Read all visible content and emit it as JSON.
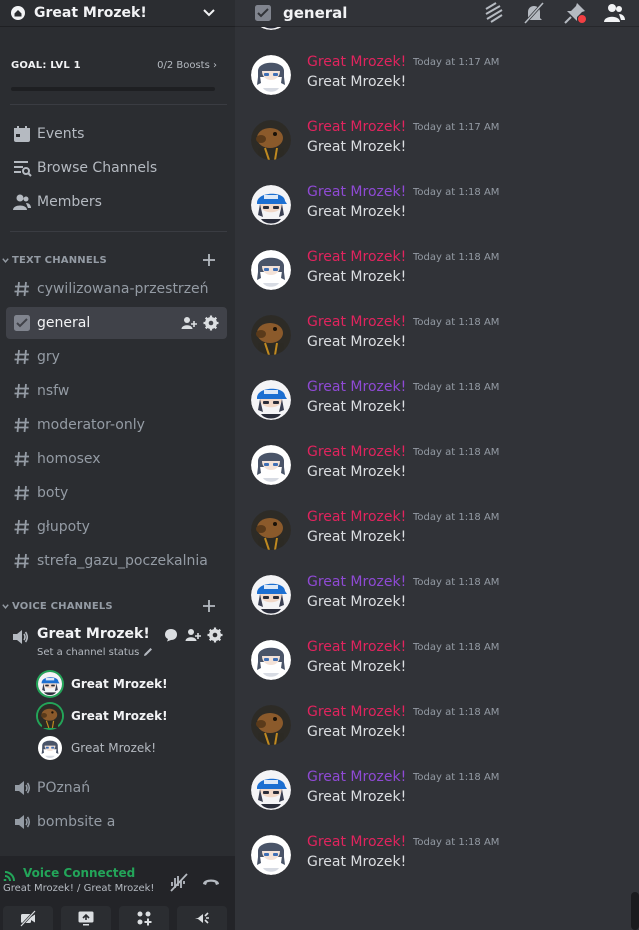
{
  "server": {
    "name": "Great Mrozek!"
  },
  "goal": {
    "label": "GOAL: LVL 1",
    "boosts": "0/2 Boosts",
    "progress": 0
  },
  "nav": [
    {
      "label": "Events",
      "icon": "calendar-icon"
    },
    {
      "label": "Browse Channels",
      "icon": "browse-channels-icon"
    },
    {
      "label": "Members",
      "icon": "members-icon"
    }
  ],
  "text_category": "TEXT CHANNELS",
  "text_channels": [
    {
      "name": "cywilizowana-przestrzeń",
      "icon": "hashtag-icon"
    },
    {
      "name": "general",
      "icon": "forum-icon",
      "active": true
    },
    {
      "name": "gry",
      "icon": "hashtag-icon"
    },
    {
      "name": "nsfw",
      "icon": "hashtag-icon"
    },
    {
      "name": "moderator-only",
      "icon": "hashtag-icon"
    },
    {
      "name": "homosex",
      "icon": "hashtag-icon"
    },
    {
      "name": "boty",
      "icon": "hashtag-icon"
    },
    {
      "name": "głupoty",
      "icon": "hashtag-icon"
    },
    {
      "name": "strefa_gazu_poczekalnia",
      "icon": "hashtag-icon"
    }
  ],
  "voice_category": "VOICE CHANNELS",
  "voice_main": {
    "name": "Great Mrozek!",
    "status_prompt": "Set a channel status"
  },
  "voice_users": [
    {
      "name": "Great Mrozek!",
      "avatar": "blue-cap",
      "speaking": true
    },
    {
      "name": "Great Mrozek!",
      "avatar": "brown",
      "speaking": true
    },
    {
      "name": "Great Mrozek!",
      "avatar": "white",
      "speaking": false
    }
  ],
  "voice_channels": [
    {
      "name": "POznań"
    },
    {
      "name": "bombsite a"
    }
  ],
  "voice_panel": {
    "status": "Voice Connected",
    "subtitle": "Great Mrozek! / Great Mrozek!"
  },
  "chat": {
    "channel": "general"
  },
  "colors": {
    "purple": "#8f4ad4",
    "pink": "#e0245e",
    "accent": "#23a559"
  },
  "messages": [
    {
      "author": "",
      "time": "",
      "text": "Great Mrozek!",
      "avatar": "blue-cap"
    },
    {
      "author": "Great Mrozek!",
      "time": "Today at 1:17 AM",
      "text": "Great Mrozek!",
      "avatar": "white",
      "color": "pink"
    },
    {
      "author": "Great Mrozek!",
      "time": "Today at 1:17 AM",
      "text": "Great Mrozek!",
      "avatar": "brown",
      "color": "pink"
    },
    {
      "author": "Great Mrozek!",
      "time": "Today at 1:18 AM",
      "text": "Great Mrozek!",
      "avatar": "blue-cap",
      "color": "purple"
    },
    {
      "author": "Great Mrozek!",
      "time": "Today at 1:18 AM",
      "text": "Great Mrozek!",
      "avatar": "white",
      "color": "pink"
    },
    {
      "author": "Great Mrozek!",
      "time": "Today at 1:18 AM",
      "text": "Great Mrozek!",
      "avatar": "brown",
      "color": "pink"
    },
    {
      "author": "Great Mrozek!",
      "time": "Today at 1:18 AM",
      "text": "Great Mrozek!",
      "avatar": "blue-cap",
      "color": "purple"
    },
    {
      "author": "Great Mrozek!",
      "time": "Today at 1:18 AM",
      "text": "Great Mrozek!",
      "avatar": "white",
      "color": "pink"
    },
    {
      "author": "Great Mrozek!",
      "time": "Today at 1:18 AM",
      "text": "Great Mrozek!",
      "avatar": "brown",
      "color": "pink"
    },
    {
      "author": "Great Mrozek!",
      "time": "Today at 1:18 AM",
      "text": "Great Mrozek!",
      "avatar": "blue-cap",
      "color": "purple"
    },
    {
      "author": "Great Mrozek!",
      "time": "Today at 1:18 AM",
      "text": "Great Mrozek!",
      "avatar": "white",
      "color": "pink"
    },
    {
      "author": "Great Mrozek!",
      "time": "Today at 1:18 AM",
      "text": "Great Mrozek!",
      "avatar": "brown",
      "color": "pink"
    },
    {
      "author": "Great Mrozek!",
      "time": "Today at 1:18 AM",
      "text": "Great Mrozek!",
      "avatar": "blue-cap",
      "color": "purple"
    },
    {
      "author": "Great Mrozek!",
      "time": "Today at 1:18 AM",
      "text": "Great Mrozek!",
      "avatar": "white",
      "color": "pink"
    }
  ]
}
